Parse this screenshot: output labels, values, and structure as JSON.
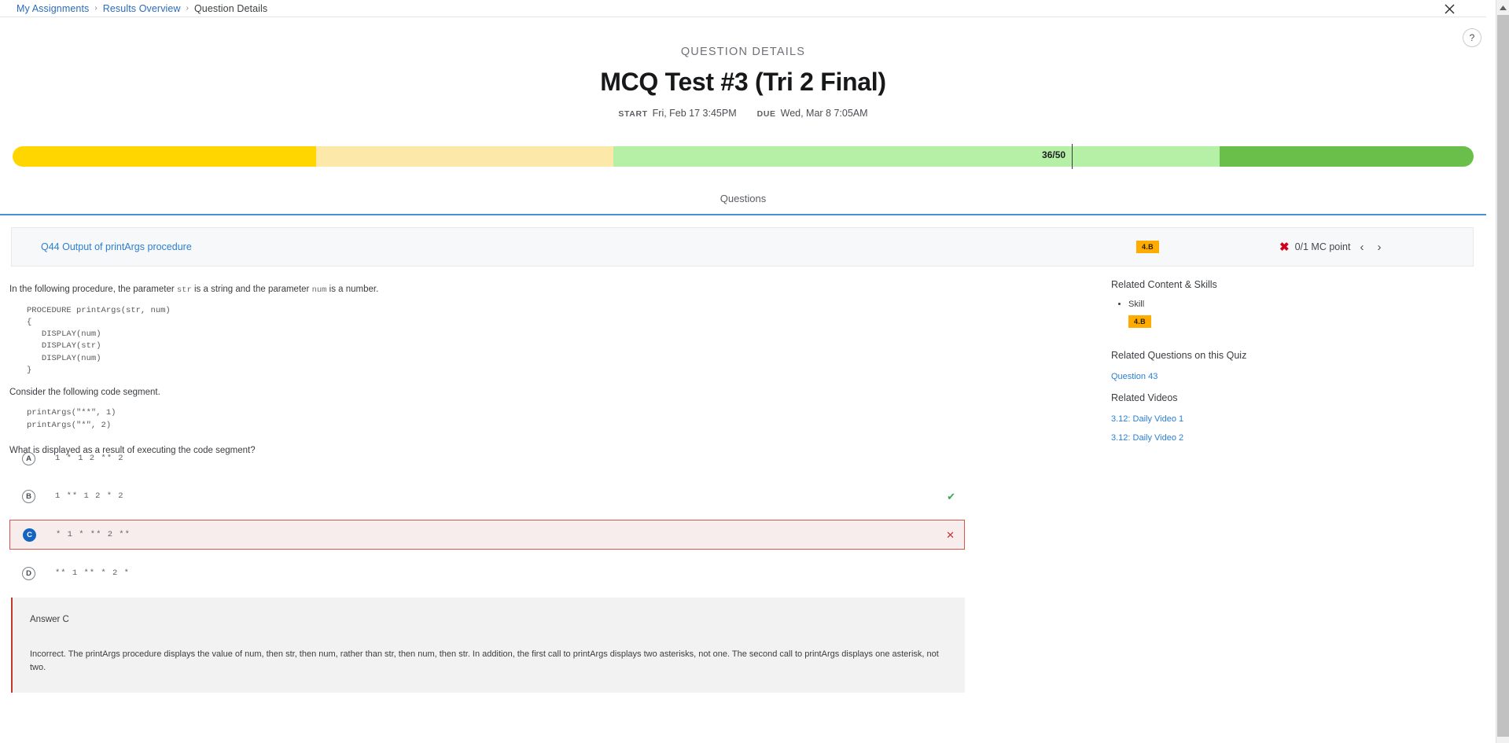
{
  "breadcrumb": {
    "items": [
      {
        "label": "My Assignments",
        "link": true
      },
      {
        "label": "Results Overview",
        "link": true
      },
      {
        "label": "Question Details",
        "link": false
      }
    ],
    "separator": "›"
  },
  "window": {
    "close_label": "✕",
    "help_label": "?",
    "scroll_up_label": "▲"
  },
  "header": {
    "eyebrow": "QUESTION DETAILS",
    "title": "MCQ Test #3 (Tri 2 Final)",
    "start_label": "START",
    "start_value": "Fri, Feb 17 3:45PM",
    "due_label": "DUE",
    "due_value": "Wed, Mar 8 7:05AM"
  },
  "progress": {
    "score_text": "36/50",
    "score_percent": 72,
    "marker_percent": 72.5,
    "segments": [
      {
        "name": "low",
        "color": "#FFD600",
        "width_percent": 20.8
      },
      {
        "name": "mid-low",
        "color": "#FCE8A8",
        "width_percent": 20.3
      },
      {
        "name": "mid-high",
        "color": "#B6EFA6",
        "width_percent": 41.5
      },
      {
        "name": "high",
        "color": "#6ABF4B",
        "width_percent": 17.4
      }
    ]
  },
  "tabs": [
    {
      "label": "Questions",
      "active": true
    }
  ],
  "question_header": {
    "title": "Q44 Output of printArgs procedure",
    "skill_badge": "4.B",
    "result_icon": "x-mark-icon",
    "score": "0/1 MC point",
    "prev_label": "‹",
    "next_label": "›"
  },
  "question": {
    "intro_part1": "In the following procedure, the parameter ",
    "intro_code1": "str",
    "intro_part2": " is a string and the parameter ",
    "intro_code2": "num",
    "intro_part3": " is a number.",
    "code_block_1": "PROCEDURE printArgs(str, num)\n{\n   DISPLAY(num)\n   DISPLAY(str)\n   DISPLAY(num)\n}",
    "consider_text": "Consider the following code segment.",
    "code_block_2": "printArgs(\"**\", 1)\nprintArgs(\"*\", 2)",
    "prompt": "What is displayed as a result of executing the code segment?"
  },
  "choices": [
    {
      "letter": "A",
      "text": "1 * 1 2 ** 2",
      "selected": false,
      "mark": ""
    },
    {
      "letter": "B",
      "text": "1 ** 1 2 * 2",
      "selected": false,
      "mark": "✔"
    },
    {
      "letter": "C",
      "text": "* 1 * ** 2 **",
      "selected": true,
      "mark": "✕"
    },
    {
      "letter": "D",
      "text": "** 1 ** * 2 *",
      "selected": false,
      "mark": ""
    }
  ],
  "explanation": {
    "answer_label": "Answer C",
    "body": "Incorrect. The printArgs procedure displays the value of num, then str, then num, rather than str, then num, then str. In addition, the first call to printArgs displays two asterisks, not one. The second call to printArgs displays one asterisk, not two."
  },
  "sidebar": {
    "related_content_heading": "Related Content & Skills",
    "skill_item": "Skill",
    "skill_badge": "4.B",
    "related_questions_heading": "Related Questions on this Quiz",
    "related_questions": [
      {
        "label": "Question 43"
      }
    ],
    "related_videos_heading": "Related Videos",
    "related_videos": [
      {
        "label": "3.12: Daily Video 1"
      },
      {
        "label": "3.12: Daily Video 2"
      }
    ]
  },
  "colors": {
    "link": "#2b7fd4",
    "badge": "#FFAB00",
    "wrong": "#d0021b",
    "correct": "#3aa757",
    "tab_underline": "#4a90d9"
  }
}
